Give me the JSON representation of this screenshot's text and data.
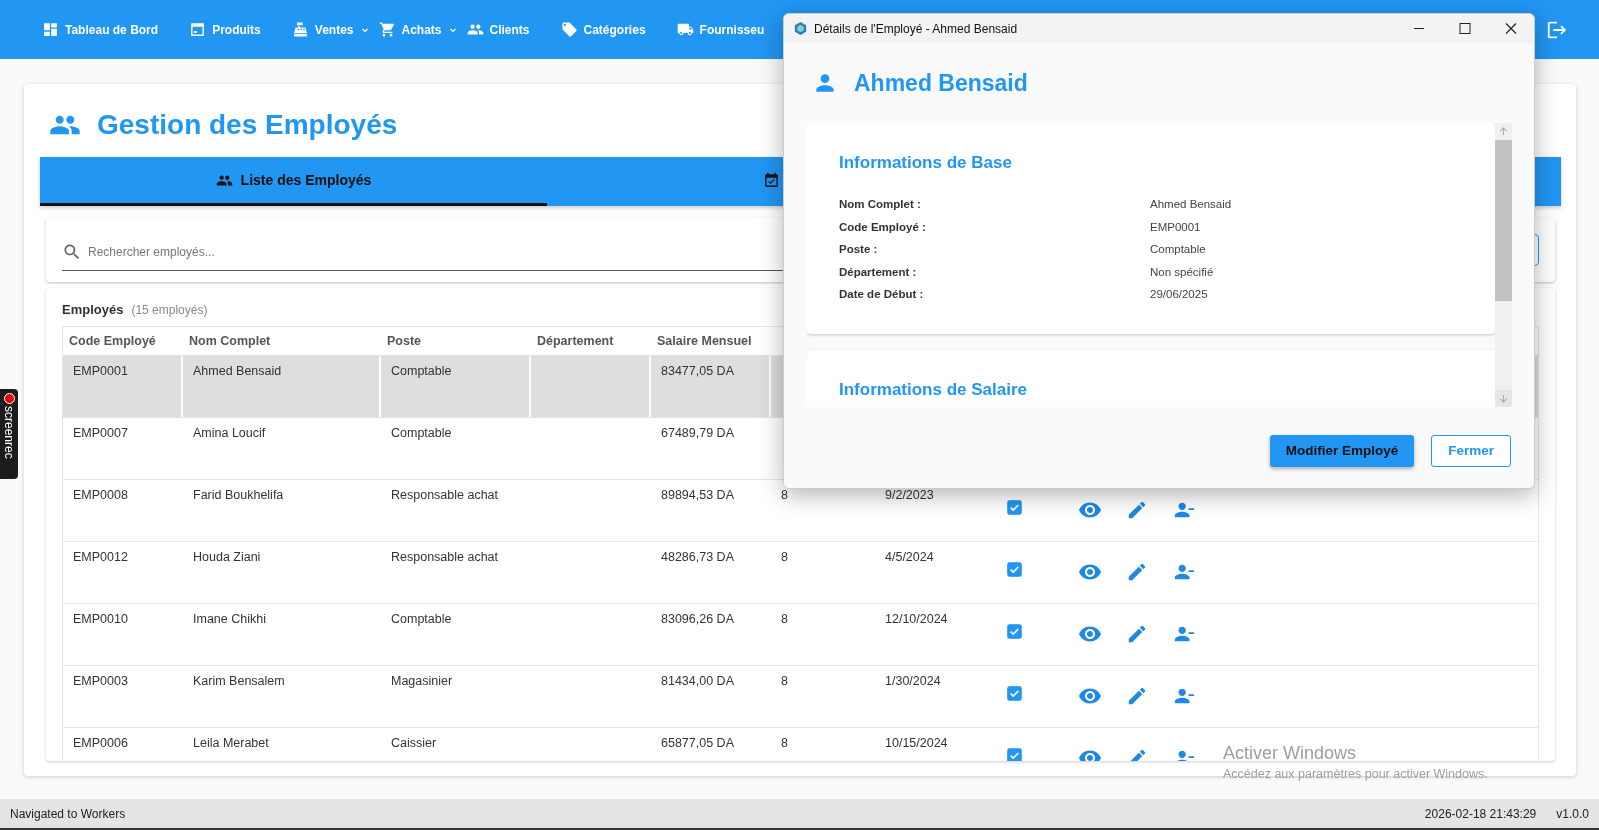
{
  "nav": {
    "items": [
      {
        "label": "Tableau de Bord",
        "caret": false
      },
      {
        "label": "Produits",
        "caret": false
      },
      {
        "label": "Ventes",
        "caret": true
      },
      {
        "label": "Achats",
        "caret": true
      },
      {
        "label": "Clients",
        "caret": false
      },
      {
        "label": "Catégories",
        "caret": false
      },
      {
        "label": "Fournisseu",
        "caret": false
      }
    ]
  },
  "page": {
    "title": "Gestion des Employés"
  },
  "tabs": [
    {
      "label": "Liste des Employés",
      "selected": true
    },
    {
      "selected": false
    }
  ],
  "search": {
    "placeholder": "Rechercher employés..."
  },
  "table": {
    "title": "Employés",
    "count": "(15 employés)",
    "columns": [
      "Code Employé",
      "Nom Complet",
      "Poste",
      "Département",
      "Salaire Mensuel"
    ],
    "rows": [
      {
        "code": "EMP0001",
        "name": "Ahmed Bensaid",
        "poste": "Comptable",
        "salary": "83477,05 DA",
        "selected": true
      },
      {
        "code": "EMP0007",
        "name": "Amina Loucif",
        "poste": "Comptable",
        "salary": "67489,79 DA",
        "selected": false
      },
      {
        "code": "EMP0008",
        "name": "Farid Boukhelifa",
        "poste": "Responsable achat",
        "salary": "89894,53 DA",
        "hours": "8",
        "date": "9/2/2023",
        "active": true,
        "selected": false
      },
      {
        "code": "EMP0012",
        "name": "Houda Ziani",
        "poste": "Responsable achat",
        "salary": "48286,73 DA",
        "hours": "8",
        "date": "4/5/2024",
        "active": true,
        "selected": false
      },
      {
        "code": "EMP0010",
        "name": "Imane Chikhi",
        "poste": "Comptable",
        "salary": "83096,26 DA",
        "hours": "8",
        "date": "12/10/2024",
        "active": true,
        "selected": false
      },
      {
        "code": "EMP0003",
        "name": "Karim Bensalem",
        "poste": "Magasinier",
        "salary": "81434,00 DA",
        "hours": "8",
        "date": "1/30/2024",
        "active": true,
        "selected": false
      },
      {
        "code": "EMP0006",
        "name": "Leila Merabet",
        "poste": "Caissier",
        "salary": "65877,05 DA",
        "hours": "8",
        "date": "10/15/2024",
        "active": true,
        "selected": false
      }
    ]
  },
  "dialog": {
    "title": "Détails de l'Employé - Ahmed Bensaid",
    "heading": "Ahmed Bensaid",
    "sections": [
      {
        "title": "Informations de Base",
        "fields": [
          {
            "label": "Nom Complet :",
            "value": "Ahmed Bensaid"
          },
          {
            "label": "Code Employé :",
            "value": "EMP0001"
          },
          {
            "label": "Poste :",
            "value": "Comptable"
          },
          {
            "label": "Département :",
            "value": "Non spécifié"
          },
          {
            "label": "Date de Début :",
            "value": "29/06/2025"
          }
        ]
      },
      {
        "title": "Informations de Salaire"
      }
    ],
    "buttons": [
      {
        "label": "Modifier Employé",
        "kind": "primary"
      },
      {
        "label": "Fermer",
        "kind": "outlined"
      }
    ]
  },
  "status_bar": {
    "message": "Navigated to Workers",
    "datetime": "2026-02-18 21:43:29",
    "version": "v1.0.0"
  },
  "os_notice": {
    "title": "Activer Windows",
    "text": "Accédez aux paramètres pour activer Windows."
  },
  "recorder": {
    "label": "screenrec"
  }
}
